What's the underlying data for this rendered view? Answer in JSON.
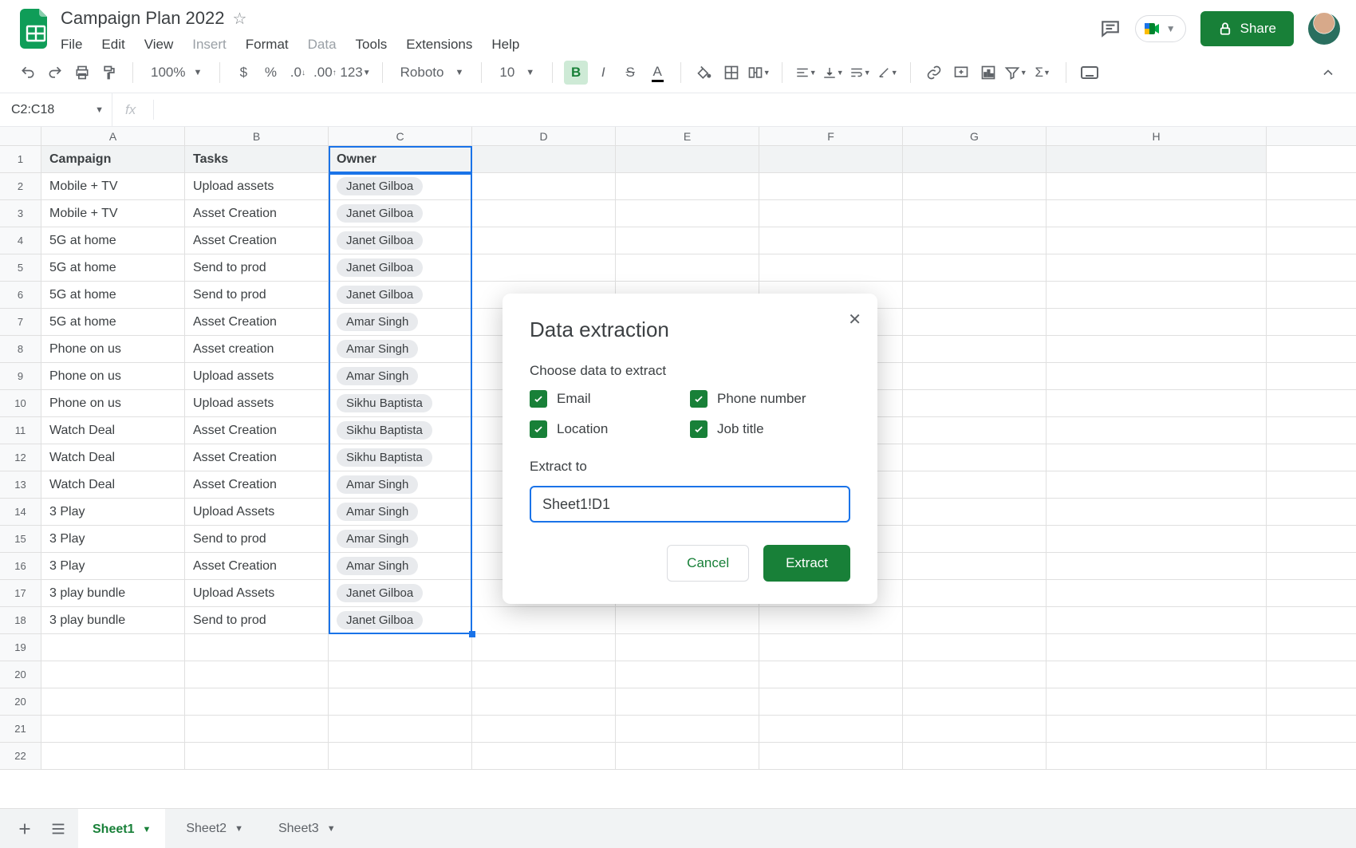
{
  "doc": {
    "title": "Campaign Plan 2022"
  },
  "menus": {
    "file": "File",
    "edit": "Edit",
    "view": "View",
    "insert": "Insert",
    "format": "Format",
    "data": "Data",
    "tools": "Tools",
    "extensions": "Extensions",
    "help": "Help"
  },
  "share": {
    "label": "Share"
  },
  "toolbar": {
    "zoom": "100%",
    "font": "Roboto",
    "size": "10"
  },
  "namebox": "C2:C18",
  "columns": {
    "A": "A",
    "B": "B",
    "C": "C",
    "D": "D",
    "E": "E",
    "F": "F",
    "G": "G",
    "H": "H"
  },
  "headers": {
    "A": "Campaign",
    "B": "Tasks",
    "C": "Owner"
  },
  "rows": [
    {
      "n": "1",
      "A": "Campaign",
      "B": "Tasks",
      "C": "Owner",
      "hdr": true
    },
    {
      "n": "2",
      "A": "Mobile + TV",
      "B": "Upload assets",
      "C": "Janet Gilboa"
    },
    {
      "n": "3",
      "A": "Mobile + TV",
      "B": "Asset Creation",
      "C": "Janet Gilboa"
    },
    {
      "n": "4",
      "A": "5G at home",
      "B": "Asset Creation",
      "C": "Janet Gilboa"
    },
    {
      "n": "5",
      "A": "5G at home",
      "B": "Send to prod",
      "C": "Janet Gilboa"
    },
    {
      "n": "6",
      "A": "5G at home",
      "B": "Send to prod",
      "C": "Janet Gilboa"
    },
    {
      "n": "7",
      "A": "5G at home",
      "B": "Asset Creation",
      "C": "Amar Singh"
    },
    {
      "n": "8",
      "A": "Phone on us",
      "B": "Asset creation",
      "C": "Amar Singh"
    },
    {
      "n": "9",
      "A": "Phone on us",
      "B": "Upload assets",
      "C": "Amar Singh"
    },
    {
      "n": "10",
      "A": "Phone on us",
      "B": "Upload assets",
      "C": "Sikhu Baptista"
    },
    {
      "n": "11",
      "A": "Watch Deal",
      "B": "Asset Creation",
      "C": "Sikhu Baptista"
    },
    {
      "n": "12",
      "A": "Watch Deal",
      "B": "Asset Creation",
      "C": "Sikhu Baptista"
    },
    {
      "n": "13",
      "A": "Watch Deal",
      "B": "Asset Creation",
      "C": "Amar Singh"
    },
    {
      "n": "14",
      "A": "3 Play",
      "B": "Upload Assets",
      "C": "Amar Singh"
    },
    {
      "n": "15",
      "A": "3 Play",
      "B": "Send to prod",
      "C": "Amar Singh"
    },
    {
      "n": "16",
      "A": "3 Play",
      "B": "Asset Creation",
      "C": "Amar Singh"
    },
    {
      "n": "17",
      "A": "3 play bundle",
      "B": "Upload Assets",
      "C": "Janet Gilboa"
    },
    {
      "n": "18",
      "A": "3 play bundle",
      "B": "Send to prod",
      "C": "Janet Gilboa"
    },
    {
      "n": "19",
      "A": "",
      "B": "",
      "C": ""
    },
    {
      "n": "20",
      "A": "",
      "B": "",
      "C": ""
    },
    {
      "n": "20",
      "A": "",
      "B": "",
      "C": ""
    },
    {
      "n": "21",
      "A": "",
      "B": "",
      "C": ""
    },
    {
      "n": "22",
      "A": "",
      "B": "",
      "C": ""
    }
  ],
  "dialog": {
    "title": "Data extraction",
    "choose": "Choose data to extract",
    "opts": {
      "email": "Email",
      "phone": "Phone number",
      "location": "Location",
      "job": "Job title"
    },
    "extract_to_label": "Extract to",
    "extract_to_value": "Sheet1!D1",
    "cancel": "Cancel",
    "extract": "Extract"
  },
  "tabs": {
    "s1": "Sheet1",
    "s2": "Sheet2",
    "s3": "Sheet3"
  }
}
